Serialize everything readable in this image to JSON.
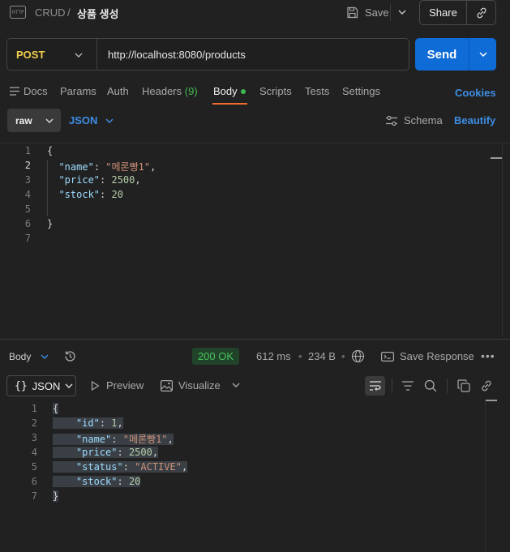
{
  "header": {
    "breadcrumb_parent": "CRUD",
    "breadcrumb_sep": "/",
    "request_title": "상품 생성",
    "save_label": "Save",
    "share_label": "Share"
  },
  "request": {
    "method": "POST",
    "url": "http://localhost:8080/products",
    "send_label": "Send"
  },
  "tabs": [
    {
      "label": "Docs"
    },
    {
      "label": "Params"
    },
    {
      "label": "Auth"
    },
    {
      "label": "Headers",
      "count": "(9)"
    },
    {
      "label": "Body",
      "active": true
    },
    {
      "label": "Scripts"
    },
    {
      "label": "Tests"
    },
    {
      "label": "Settings"
    }
  ],
  "cookies_label": "Cookies",
  "body_options": {
    "mode": "raw",
    "language": "JSON",
    "schema_label": "Schema",
    "beautify_label": "Beautify"
  },
  "request_body": {
    "line_numbers": [
      "1",
      "2",
      "3",
      "4",
      "5",
      "6",
      "7"
    ],
    "lines": [
      {
        "parts": [
          [
            "p",
            "{"
          ]
        ]
      },
      {
        "parts": [
          [
            "p",
            "  "
          ],
          [
            "k",
            "\"name\""
          ],
          [
            "p",
            ": "
          ],
          [
            "s",
            "\"메론빵1\""
          ],
          [
            "p",
            ","
          ]
        ]
      },
      {
        "parts": [
          [
            "p",
            "  "
          ],
          [
            "k",
            "\"price\""
          ],
          [
            "p",
            ": "
          ],
          [
            "n",
            "2500"
          ],
          [
            "p",
            ","
          ]
        ]
      },
      {
        "parts": [
          [
            "p",
            "  "
          ],
          [
            "k",
            "\"stock\""
          ],
          [
            "p",
            ": "
          ],
          [
            "n",
            "20"
          ]
        ]
      },
      {
        "parts": []
      },
      {
        "parts": [
          [
            "p",
            "}"
          ]
        ]
      },
      {
        "parts": []
      }
    ]
  },
  "response": {
    "section_label": "Body",
    "status": "200 OK",
    "time": "612 ms",
    "size": "234 B",
    "save_response_label": "Save Response",
    "format": "JSON",
    "preview_label": "Preview",
    "visualize_label": "Visualize",
    "line_numbers": [
      "1",
      "2",
      "3",
      "4",
      "5",
      "6",
      "7"
    ],
    "lines": [
      {
        "parts": [
          [
            "p",
            "{"
          ]
        ]
      },
      {
        "parts": [
          [
            "p",
            "    "
          ],
          [
            "k",
            "\"id\""
          ],
          [
            "p",
            ": "
          ],
          [
            "n",
            "1"
          ],
          [
            "p",
            ","
          ]
        ]
      },
      {
        "parts": [
          [
            "p",
            "    "
          ],
          [
            "k",
            "\"name\""
          ],
          [
            "p",
            ": "
          ],
          [
            "s",
            "\"메론빵1\""
          ],
          [
            "p",
            ","
          ]
        ]
      },
      {
        "parts": [
          [
            "p",
            "    "
          ],
          [
            "k",
            "\"price\""
          ],
          [
            "p",
            ": "
          ],
          [
            "n",
            "2500"
          ],
          [
            "p",
            ","
          ]
        ]
      },
      {
        "parts": [
          [
            "p",
            "    "
          ],
          [
            "k",
            "\"status\""
          ],
          [
            "p",
            ": "
          ],
          [
            "s",
            "\"ACTIVE\""
          ],
          [
            "p",
            ","
          ]
        ]
      },
      {
        "parts": [
          [
            "p",
            "    "
          ],
          [
            "k",
            "\"stock\""
          ],
          [
            "p",
            ": "
          ],
          [
            "n",
            "20"
          ]
        ]
      },
      {
        "parts": [
          [
            "p",
            "}"
          ]
        ]
      }
    ]
  },
  "colors": {
    "accent_blue": "#0f6bd6",
    "method_yellow": "#f2cc4d",
    "status_green": "#48c35d",
    "tab_underline": "#ef6c2c"
  }
}
